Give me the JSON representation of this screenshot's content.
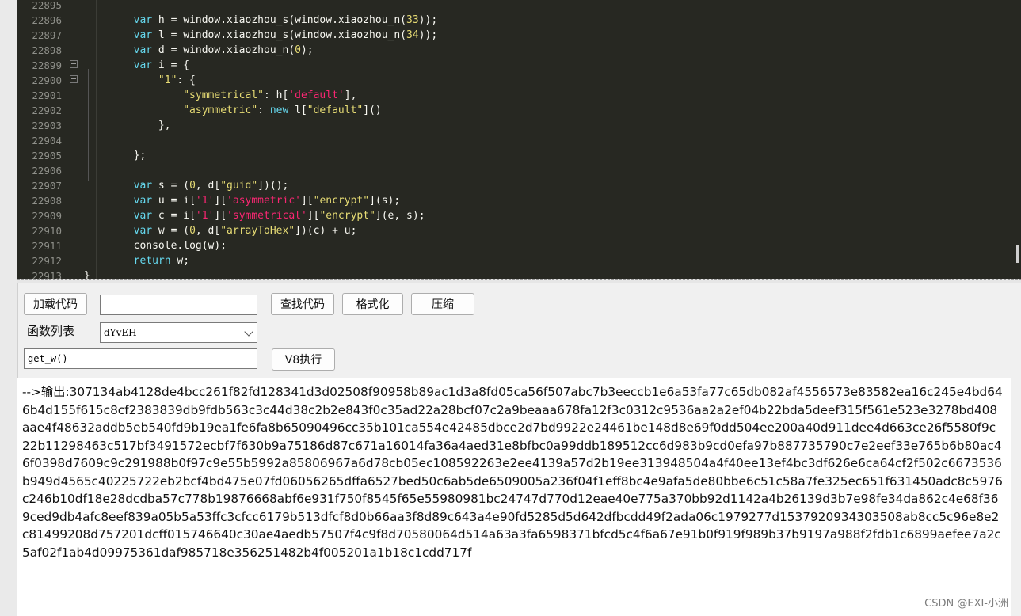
{
  "editor": {
    "lines": [
      {
        "n": "22895",
        "segs": []
      },
      {
        "n": "22896",
        "segs": [
          [
            "i",
            "        "
          ],
          [
            "kw",
            "var"
          ],
          [
            "t",
            " h = window.xiaozhou_s(window.xiaozhou_n("
          ],
          [
            "num",
            "33"
          ],
          [
            "t",
            "));"
          ]
        ]
      },
      {
        "n": "22897",
        "segs": [
          [
            "i",
            "        "
          ],
          [
            "kw",
            "var"
          ],
          [
            "t",
            " l = window.xiaozhou_s(window.xiaozhou_n("
          ],
          [
            "num",
            "34"
          ],
          [
            "t",
            "));"
          ]
        ]
      },
      {
        "n": "22898",
        "segs": [
          [
            "i",
            "        "
          ],
          [
            "kw",
            "var"
          ],
          [
            "t",
            " d = window.xiaozhou_n("
          ],
          [
            "num",
            "0"
          ],
          [
            "t",
            ");"
          ]
        ]
      },
      {
        "n": "22899",
        "fold": true,
        "segs": [
          [
            "i",
            "        "
          ],
          [
            "kw",
            "var"
          ],
          [
            "t",
            " i = {"
          ]
        ]
      },
      {
        "n": "22900",
        "fold": true,
        "segs": [
          [
            "i",
            "            "
          ],
          [
            "str",
            "\"1\""
          ],
          [
            "t",
            ": {"
          ]
        ]
      },
      {
        "n": "22901",
        "segs": [
          [
            "i",
            "                "
          ],
          [
            "str",
            "\"symmetrical\""
          ],
          [
            "t",
            ": h["
          ],
          [
            "sq",
            "'default'"
          ],
          [
            "t",
            "],"
          ]
        ]
      },
      {
        "n": "22902",
        "segs": [
          [
            "i",
            "                "
          ],
          [
            "str",
            "\"asymmetric\""
          ],
          [
            "t",
            ": "
          ],
          [
            "kw",
            "new"
          ],
          [
            "t",
            " l["
          ],
          [
            "str",
            "\"default\""
          ],
          [
            "t",
            "]()"
          ]
        ]
      },
      {
        "n": "22903",
        "segs": [
          [
            "i",
            "            "
          ],
          [
            "t",
            "},"
          ]
        ]
      },
      {
        "n": "22904",
        "segs": []
      },
      {
        "n": "22905",
        "segs": [
          [
            "i",
            "        "
          ],
          [
            "t",
            "};"
          ]
        ]
      },
      {
        "n": "22906",
        "segs": []
      },
      {
        "n": "22907",
        "segs": [
          [
            "i",
            "        "
          ],
          [
            "kw",
            "var"
          ],
          [
            "t",
            " s = ("
          ],
          [
            "num",
            "0"
          ],
          [
            "t",
            ", d["
          ],
          [
            "str",
            "\"guid\""
          ],
          [
            "t",
            "])();"
          ]
        ]
      },
      {
        "n": "22908",
        "segs": [
          [
            "i",
            "        "
          ],
          [
            "kw",
            "var"
          ],
          [
            "t",
            " u = i["
          ],
          [
            "sq",
            "'1'"
          ],
          [
            "t",
            "]["
          ],
          [
            "sq",
            "'asymmetric'"
          ],
          [
            "t",
            "]["
          ],
          [
            "str",
            "\"encrypt\""
          ],
          [
            "t",
            "](s);"
          ]
        ]
      },
      {
        "n": "22909",
        "segs": [
          [
            "i",
            "        "
          ],
          [
            "kw",
            "var"
          ],
          [
            "t",
            " c = i["
          ],
          [
            "sq",
            "'1'"
          ],
          [
            "t",
            "]["
          ],
          [
            "sq",
            "'symmetrical'"
          ],
          [
            "t",
            "]["
          ],
          [
            "str",
            "\"encrypt\""
          ],
          [
            "t",
            "](e, s);"
          ]
        ]
      },
      {
        "n": "22910",
        "segs": [
          [
            "i",
            "        "
          ],
          [
            "kw",
            "var"
          ],
          [
            "t",
            " w = ("
          ],
          [
            "num",
            "0"
          ],
          [
            "t",
            ", d["
          ],
          [
            "str",
            "\"arrayToHex\""
          ],
          [
            "t",
            "])(c) + u;"
          ]
        ]
      },
      {
        "n": "22911",
        "segs": [
          [
            "i",
            "        "
          ],
          [
            "t",
            "console.log(w);"
          ]
        ]
      },
      {
        "n": "22912",
        "segs": [
          [
            "i",
            "        "
          ],
          [
            "kw",
            "return"
          ],
          [
            "t",
            " w;"
          ]
        ]
      },
      {
        "n": "22913",
        "segs": [
          [
            "i",
            ""
          ],
          [
            "t",
            "}"
          ]
        ]
      }
    ]
  },
  "toolbar": {
    "load_code": "加载代码",
    "search_value": "",
    "find_code": "查找代码",
    "format": "格式化",
    "compress": "压缩",
    "func_list_label": "函数列表",
    "func_selected": "dYvEH",
    "call_expr": "get_w()",
    "run_v8": "V8执行"
  },
  "output": {
    "text": "-->输出:307134ab4128de4bcc261f82fd128341d3d02508f90958b89ac1d3a8fd05ca56f507abc7b3eeccb1e6a53fa77c65db082af4556573e83582ea16c245e4bd646b4d155f615c8cf2383839db9fdb563c3c44d38c2b2e843f0c35ad22a28bcf07c2a9beaaa678fa12f3c0312c9536aa2a2ef04b22bda5deef315f561e523e3278bd408aae4f48632addb5eb540fd9b19ea1fe6fa8b65090496cc35b101ca554e42485dbce2d7bd9922e24461be148d8e69f0dd504ee200a40d911dee4d663ce26f5580f9c22b11298463c517bf3491572ecbf7f630b9a75186d87c671a16014fa36a4aed31e8bfbc0a99ddb189512cc6d983b9cd0efa97b887735790c7e2eef33e765b6b80ac46f0398d7609c9c291988b0f97c9e55b5992a85806967a6d78cb05ec108592263e2ee4139a57d2b19ee313948504a4f40ee13ef4bc3df626e6ca64cf2f502c6673536b949d4565c40225722eb2bcf4bd475e07fd06056265dffa6527bed50c6ab5de6509005a236f04f1eff8bc4e9afa5de80bbe6c51c58a7fe325ec651f631450adc8c5976c246b10df18e28dcdba57c778b19876668abf6e931f750f8545f65e55980981bc24747d770d12eae40e775a370bb92d1142a4b26139d3b7e98fe34da862c4e68f369ced9db4afc8eef839a05b5a53ffc3cfcc6179b513dfcf8d0b66aa3f8d89c643a4e90fd5285d5d642dfbcdd49f2ada06c1979277d1537920934303508ab8cc5c96e8e2c81499208d757201dcff015746640c30ae4aedb57507f4c9f8d70580064d514a63a3fa6598371bfcd5c4f6a67e91b0f919f989b37b9197a988f2fdb1c6899aefee7a2c5af02f1ab4d09975361daf985718e356251482b4f005201a1b18c1cdd717f"
  },
  "watermark": "CSDN @EXI-小洲"
}
